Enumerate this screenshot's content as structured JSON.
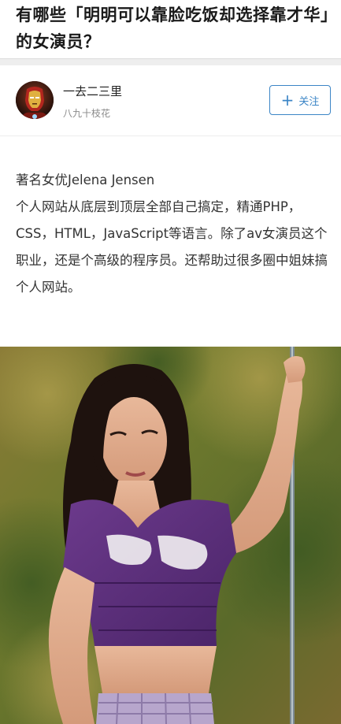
{
  "question": {
    "title": "有哪些「明明可以靠脸吃饭却选择靠才华」的女演员？"
  },
  "author": {
    "name": "一去二三里",
    "bio": "八九十枝花",
    "avatar_icon": "iron-man-avatar-icon"
  },
  "follow_button": {
    "label": "关注",
    "icon": "plus-icon",
    "color": "#3b85c6"
  },
  "answer": {
    "lines": [
      "著名女优Jelena Jensen",
      "个人网站从底层到顶层全部自己搞定，精通PHP，CSS，HTML，JavaScript等语言。除了av女演员这个职业，还是个高级的程序员。还帮助过很多圈中姐妹搞个人网站。"
    ]
  },
  "photo": {
    "icon": "photo-image"
  }
}
